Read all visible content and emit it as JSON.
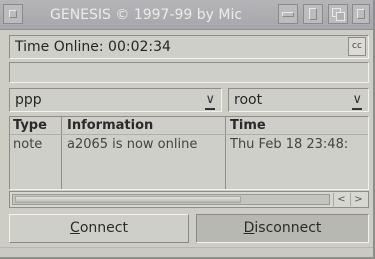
{
  "window": {
    "title": "GENESIS © 1997-99 by Mic",
    "buttons": [
      "close-icon",
      "zoom-icon",
      "iconify-icon",
      "depth-icon"
    ]
  },
  "status": {
    "label": "Time Online: 00:02:34",
    "indicator": "cc"
  },
  "selects": {
    "interface": {
      "value": "ppp"
    },
    "user": {
      "value": "root"
    }
  },
  "table": {
    "columns": [
      "Type",
      "Information",
      "Time"
    ],
    "rows": [
      {
        "type": "note",
        "information": "a2065 is now online",
        "time": "Thu Feb 18 23:48:"
      }
    ]
  },
  "scrollbar": {
    "position_fraction": 0.0,
    "visible_fraction": 0.72
  },
  "buttons": {
    "connect": {
      "label": "Connect"
    },
    "disconnect": {
      "label": "Disconnect"
    }
  },
  "colors": {
    "window_bg": "#cdcdc6",
    "titlebar_bg": "#b0b0b4",
    "title_text": "#ebebed"
  }
}
